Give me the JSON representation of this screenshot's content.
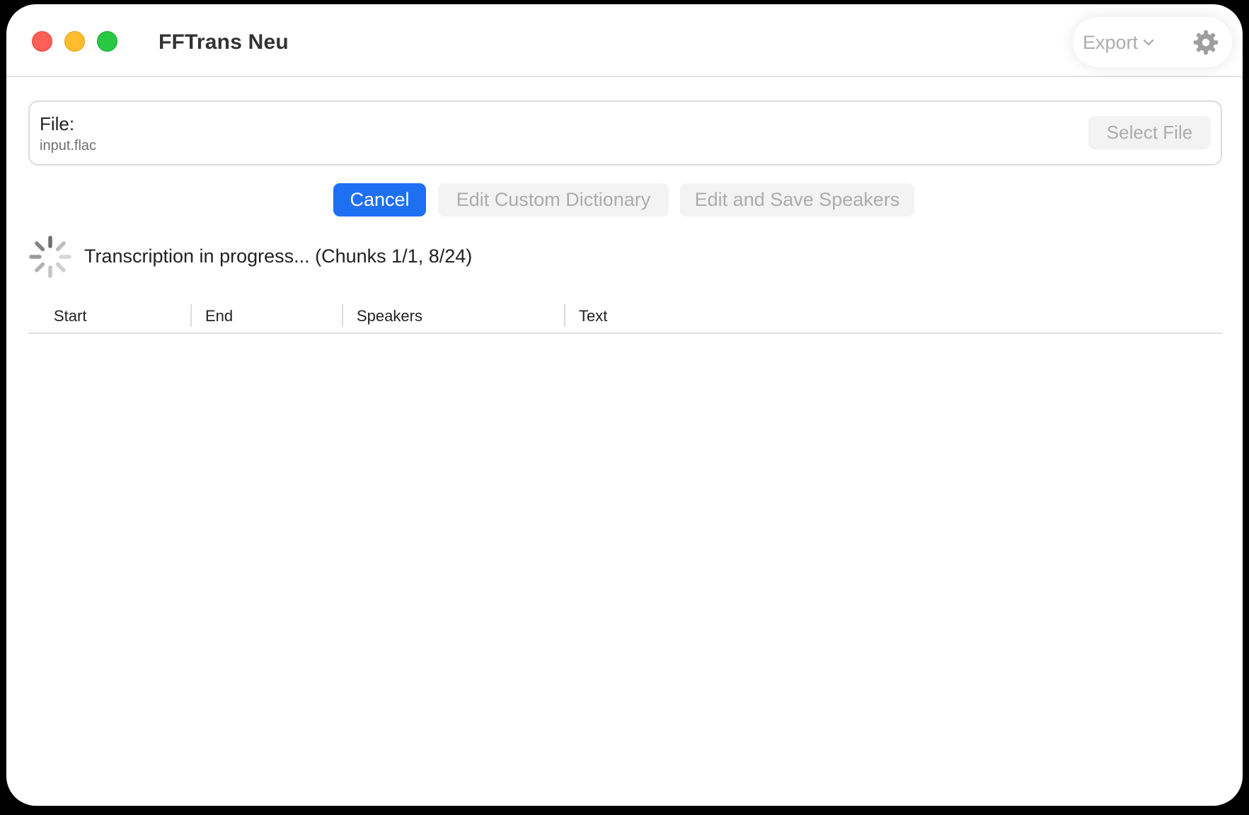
{
  "window": {
    "title": "FFTrans Neu"
  },
  "toolbar": {
    "export_label": "Export",
    "export_icon": "chevron-down-icon",
    "settings_icon": "gear-icon"
  },
  "file_section": {
    "label": "File:",
    "file_name": "input.flac",
    "select_button": "Select File"
  },
  "actions": {
    "cancel": "Cancel",
    "edit_dictionary": "Edit Custom Dictionary",
    "edit_speakers": "Edit and Save Speakers"
  },
  "status": {
    "icon": "spinner-icon",
    "text": "Transcription in progress... (Chunks 1/1, 8/24)"
  },
  "table": {
    "columns": [
      "Start",
      "End",
      "Speakers",
      "Text"
    ],
    "rows": []
  },
  "colors": {
    "accent": "#1f6ff3",
    "close": "#fe5f57",
    "minimize": "#febc2e",
    "maximize": "#28c840",
    "disabled_text": "#acacac"
  }
}
